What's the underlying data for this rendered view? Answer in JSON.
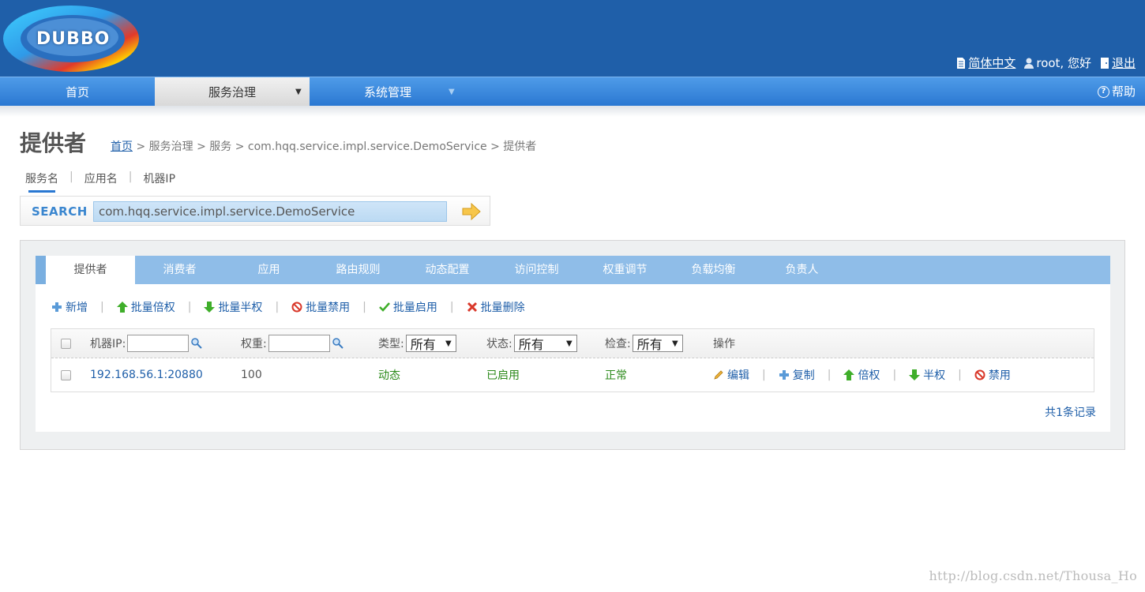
{
  "header": {
    "logo_text": "DUBBO",
    "lang_label": "简体中文",
    "user_label": "root, 您好",
    "logout_label": "退出"
  },
  "nav": {
    "items": [
      {
        "label": "首页"
      },
      {
        "label": "服务治理"
      },
      {
        "label": "系统管理"
      }
    ],
    "help_label": "帮助"
  },
  "page": {
    "title": "提供者",
    "breadcrumb": {
      "home": "首页",
      "rest": " > 服务治理 > 服务 > com.hqq.service.impl.service.DemoService > 提供者"
    }
  },
  "search": {
    "types": [
      "服务名",
      "应用名",
      "机器IP"
    ],
    "label": "SEARCH",
    "value": "com.hqq.service.impl.service.DemoService"
  },
  "tabs": [
    "提供者",
    "消费者",
    "应用",
    "路由规则",
    "动态配置",
    "访问控制",
    "权重调节",
    "负载均衡",
    "负责人"
  ],
  "toolbar": {
    "add": "新增",
    "batch_double": "批量倍权",
    "batch_half": "批量半权",
    "batch_disable": "批量禁用",
    "batch_enable": "批量启用",
    "batch_delete": "批量删除"
  },
  "table": {
    "headers": {
      "ip": "机器IP:",
      "weight": "权重:",
      "type": "类型:",
      "status": "状态:",
      "check": "检查:",
      "ops": "操作"
    },
    "filters": {
      "type_value": "所有",
      "status_value": "所有",
      "check_value": "所有"
    },
    "rows": [
      {
        "address": "192.168.56.1:20880",
        "weight": "100",
        "type": "动态",
        "status": "已启用",
        "check": "正常",
        "ops": {
          "edit": "编辑",
          "copy": "复制",
          "double": "倍权",
          "half": "半权",
          "disable": "禁用"
        }
      }
    ],
    "total": "共1条记录"
  },
  "watermark": "http://blog.csdn.net/Thousa_Ho",
  "colors": {
    "header_bg": "#1f5fa9",
    "tab_bg": "#8fbde8",
    "link": "#1f5fa9",
    "status_green": "#2b8a1a"
  }
}
